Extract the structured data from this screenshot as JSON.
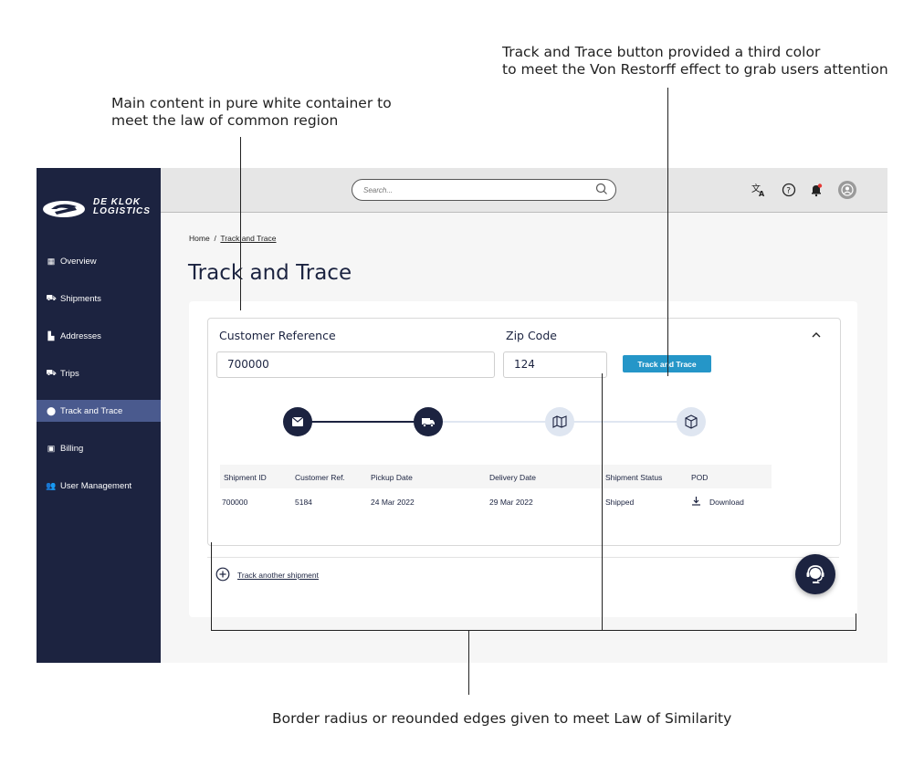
{
  "annotations": {
    "top_right_line1": "Track and Trace button provided a third color",
    "top_right_line2": "to meet the Von Restorff effect to grab users attention",
    "top_left_line1": "Main content in pure white container to",
    "top_left_line2": "meet the law of common region",
    "bottom": "Border radius or reounded edges given to meet Law of Similarity"
  },
  "brand": {
    "line1": "DE KLOK",
    "line2": "LOGISTICS"
  },
  "sidebar": {
    "items": [
      {
        "label": "Overview",
        "icon": "grid-icon"
      },
      {
        "label": "Shipments",
        "icon": "truck-icon"
      },
      {
        "label": "Addresses",
        "icon": "building-icon"
      },
      {
        "label": "Trips",
        "icon": "truck-icon"
      },
      {
        "label": "Track and Trace",
        "icon": "location-pin-icon"
      },
      {
        "label": "Billing",
        "icon": "billing-icon"
      },
      {
        "label": "User Management",
        "icon": "users-icon"
      }
    ]
  },
  "search": {
    "placeholder": "Search..."
  },
  "breadcrumb": {
    "home": "Home",
    "sep": "/",
    "current": "Track and Trace"
  },
  "page": {
    "title": "Track and Trace"
  },
  "form": {
    "customer_ref_label": "Customer Reference",
    "customer_ref_value": "700000",
    "zip_label": "Zip Code",
    "zip_value": "124",
    "button": "Track and Trace"
  },
  "progress": {
    "steps": [
      {
        "icon": "mail-icon",
        "state": "done"
      },
      {
        "icon": "truck-icon",
        "state": "done"
      },
      {
        "icon": "map-icon",
        "state": "todo"
      },
      {
        "icon": "package-icon",
        "state": "todo"
      }
    ]
  },
  "table": {
    "headers": [
      "Shipment ID",
      "Customer Ref.",
      "Pickup Date",
      "Delivery Date",
      "Shipment Status",
      "POD"
    ],
    "rows": [
      [
        "700000",
        "5184",
        "24 Mar 2022",
        "29 Mar 2022",
        "Shipped",
        "Download"
      ]
    ]
  },
  "footer": {
    "add_link": "Track another shipment"
  },
  "colors": {
    "navy": "#1c2340",
    "accent": "#2596c8",
    "active_nav": "#4a5a8e"
  }
}
